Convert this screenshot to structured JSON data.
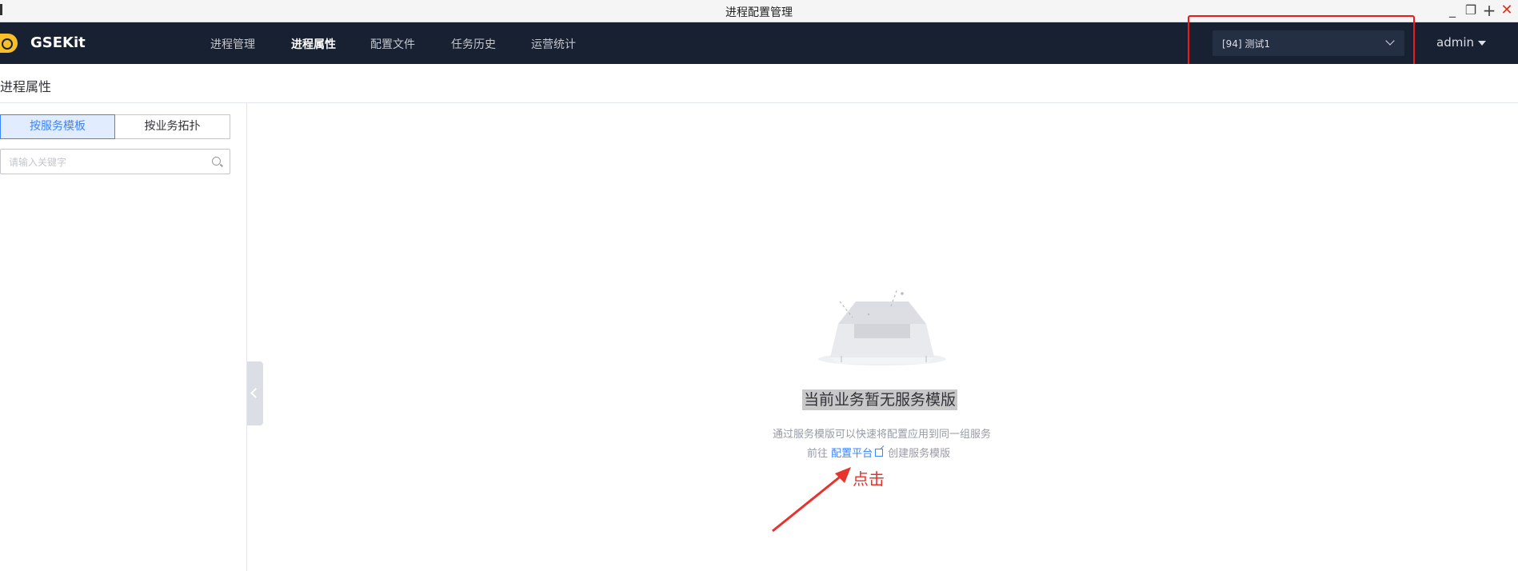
{
  "window": {
    "title": "进程配置管理"
  },
  "app": {
    "name": "GSEKit"
  },
  "nav": [
    {
      "label": "进程管理",
      "active": false
    },
    {
      "label": "进程属性",
      "active": true
    },
    {
      "label": "配置文件",
      "active": false
    },
    {
      "label": "任务历史",
      "active": false
    },
    {
      "label": "运营统计",
      "active": false
    }
  ],
  "business_select": {
    "value": "[94] 测试1"
  },
  "user": {
    "name": "admin"
  },
  "page": {
    "title": "进程属性"
  },
  "sidebar": {
    "tabs": [
      {
        "label": "按服务模板",
        "selected": true
      },
      {
        "label": "按业务拓扑",
        "selected": false
      }
    ],
    "search": {
      "placeholder": "请输入关键字",
      "value": ""
    }
  },
  "empty_state": {
    "title": "当前业务暂无服务模版",
    "description": "通过服务模版可以快速将配置应用到同一组服务",
    "link_prefix": "前往",
    "link_label": "配置平台",
    "link_suffix": "创建服务模版"
  },
  "annotation": {
    "text": "点击",
    "color": "#e8322c"
  },
  "colors": {
    "header_bg": "#182132",
    "accent": "#3a84ff",
    "highlight_box": "#f01818"
  }
}
